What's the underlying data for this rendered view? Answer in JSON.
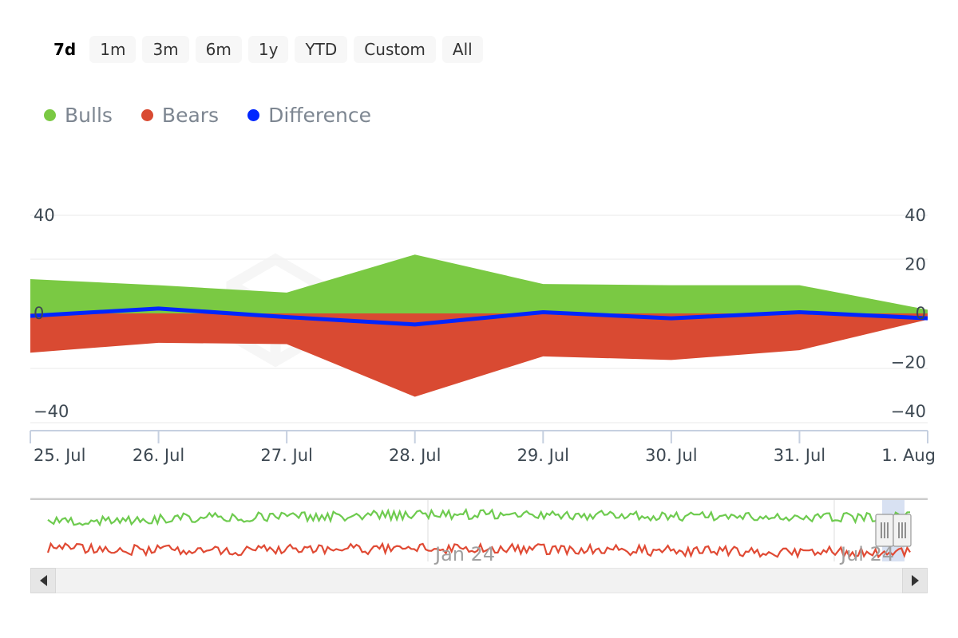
{
  "range_selector": {
    "buttons": [
      {
        "label": "7d",
        "selected": true
      },
      {
        "label": "1m",
        "selected": false
      },
      {
        "label": "3m",
        "selected": false
      },
      {
        "label": "6m",
        "selected": false
      },
      {
        "label": "1y",
        "selected": false
      },
      {
        "label": "YTD",
        "selected": false
      },
      {
        "label": "Custom",
        "selected": false
      },
      {
        "label": "All",
        "selected": false
      }
    ]
  },
  "legend": {
    "items": [
      {
        "label": "Bulls",
        "color": "#7ac943"
      },
      {
        "label": "Bears",
        "color": "#d94a32"
      },
      {
        "label": "Difference",
        "color": "#0026ff"
      }
    ]
  },
  "navigator": {
    "labels": [
      "Jan 24",
      "Jul 24"
    ],
    "series_colors": {
      "bulls": "#6ecb4f",
      "bears": "#e04a34"
    },
    "selected_range_fill": "#b8c8e8",
    "handle_count": 2,
    "scroll_left_icon": "triangle-left-icon",
    "scroll_right_icon": "triangle-right-icon"
  },
  "chart_data": {
    "type": "area",
    "title": "",
    "xlabel": "",
    "ylabel": "",
    "ylim": [
      -40,
      40
    ],
    "yticks": [
      -40,
      -20,
      0,
      20,
      40
    ],
    "left_axis_ticks": [
      "40",
      "0",
      "-40"
    ],
    "right_axis_ticks": [
      "40",
      "20",
      "0",
      "-20",
      "-40"
    ],
    "grid": true,
    "legend_position": "top-left",
    "categories": [
      "25. Jul",
      "26. Jul",
      "27. Jul",
      "28. Jul",
      "29. Jul",
      "30. Jul",
      "31. Jul",
      "1. Aug"
    ],
    "series": [
      {
        "name": "Bulls",
        "color": "#7ac943",
        "values": [
          14.0,
          11.5,
          8.5,
          24.0,
          12.0,
          11.5,
          11.5,
          1.5
        ]
      },
      {
        "name": "Bears",
        "color": "#d94a32",
        "values": [
          -16.0,
          -12.0,
          -12.5,
          -34.0,
          -17.5,
          -19.0,
          -15.0,
          -2.5
        ]
      },
      {
        "name": "Difference",
        "color": "#0026ff",
        "values": [
          -1.0,
          2.0,
          -1.5,
          -4.5,
          0.5,
          -2.0,
          0.5,
          -2.0
        ]
      }
    ]
  }
}
